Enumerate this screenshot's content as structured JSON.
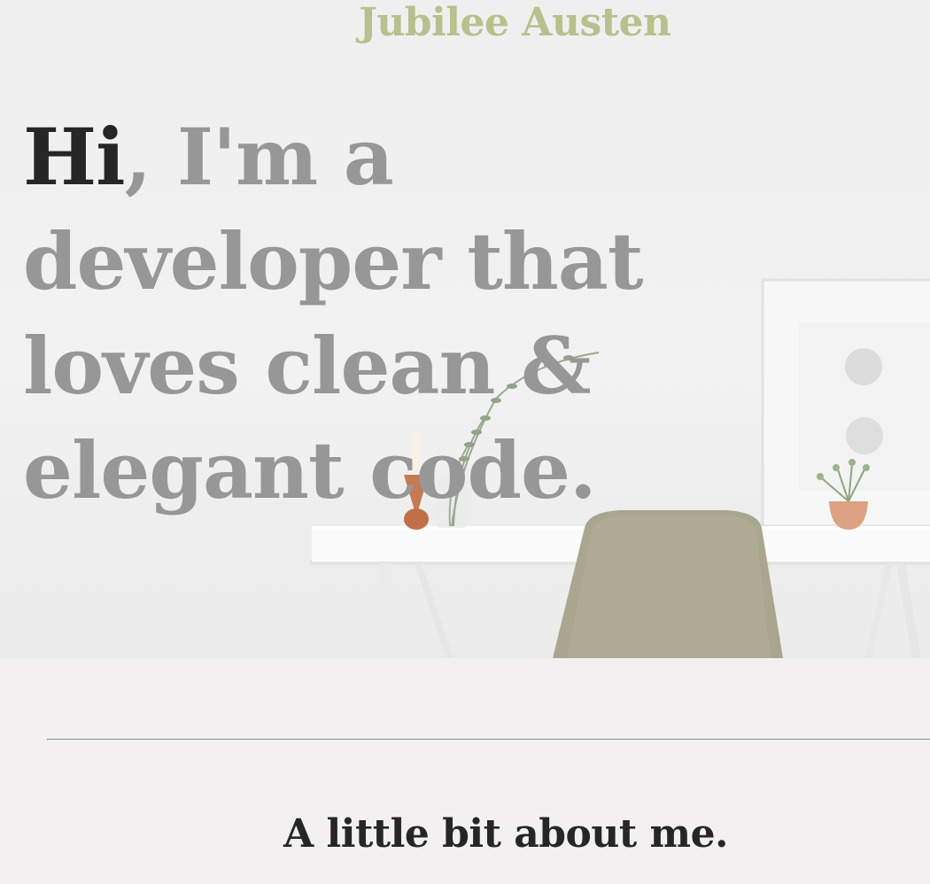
{
  "header": {
    "site_name": "Jubilee Austen"
  },
  "hero": {
    "greeting": "Hi",
    "headline_rest": ", I'm a developer that loves clean & elegant code."
  },
  "about": {
    "title": "A little bit about me."
  },
  "colors": {
    "accent": "#b8c08d",
    "headline_gray": "#979797",
    "dark_text": "#262626",
    "background": "#f2f0f1"
  }
}
